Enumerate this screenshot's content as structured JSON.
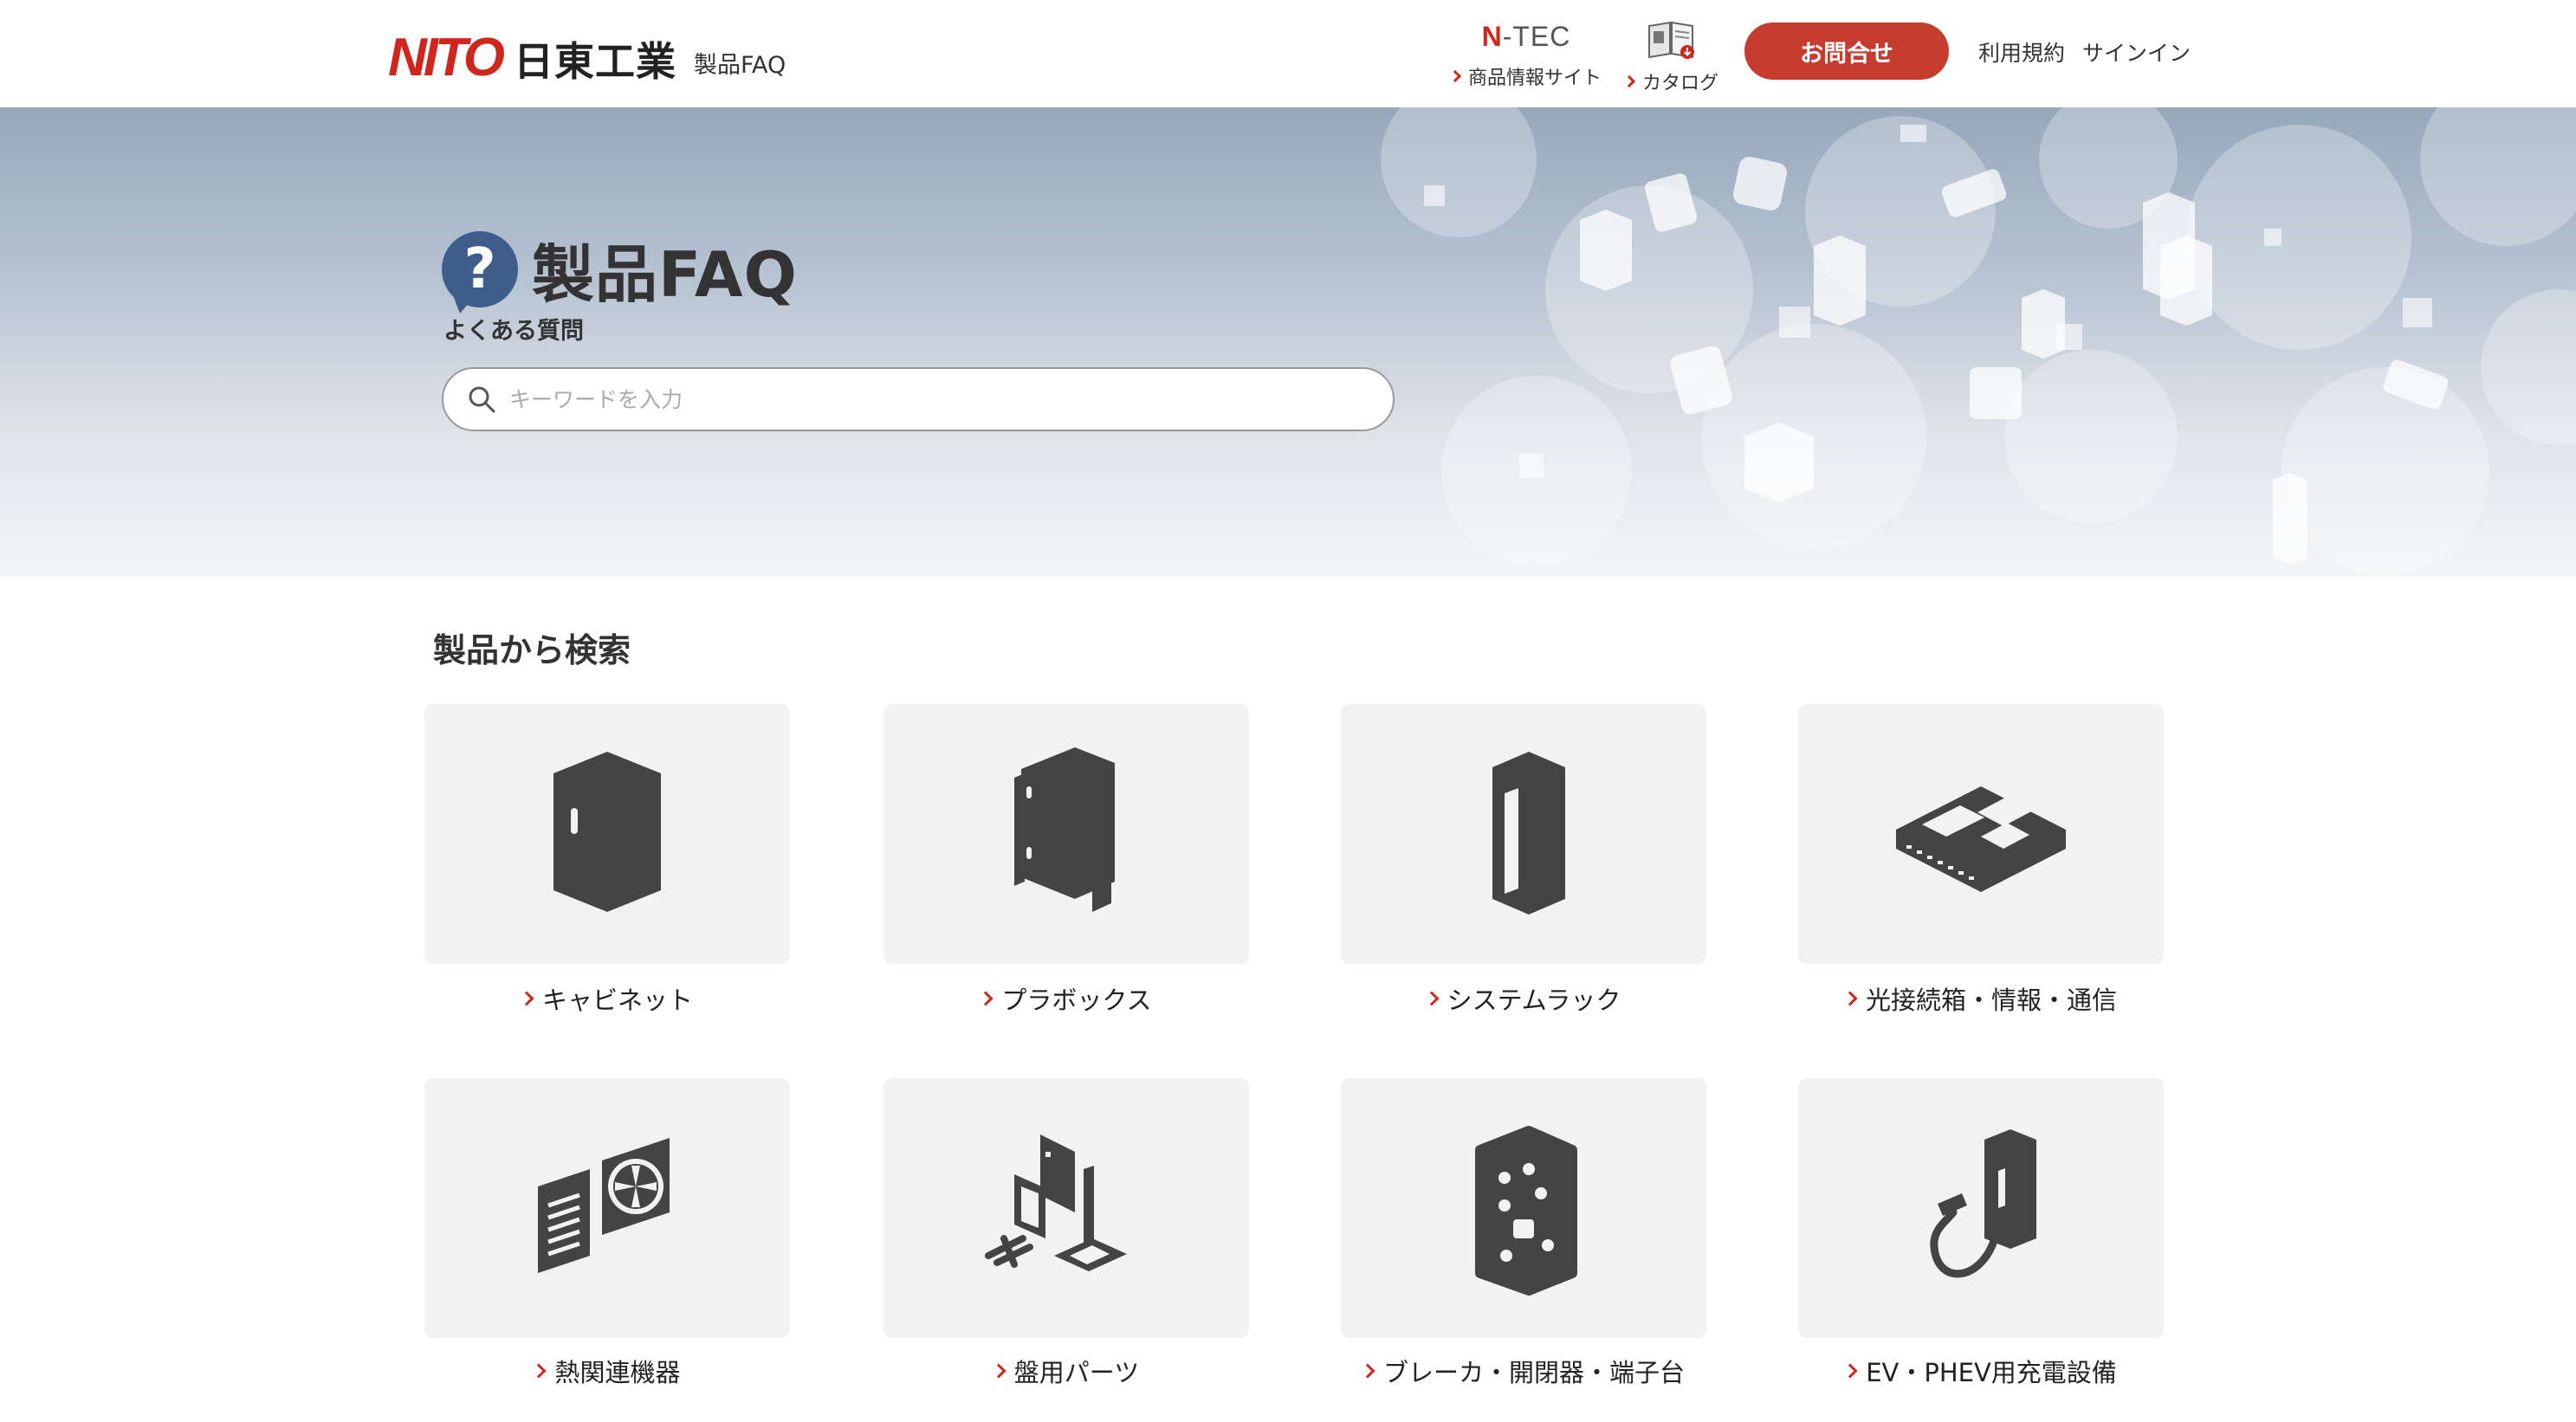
{
  "header": {
    "logo_mark": "NITO",
    "logo_kanji": "日東工業",
    "logo_sub": "製品FAQ",
    "ntec_logo_n": "N",
    "ntec_logo_rest": "-TEC",
    "ntec_link": "商品情報サイト",
    "catalog_link": "カタログ",
    "contact_button": "お問合せ",
    "terms_link": "利用規約",
    "signin_link": "サインイン",
    "accent_color": "#c63c2e"
  },
  "hero": {
    "title": "製品FAQ",
    "subtitle": "よくある質問",
    "question_mark": "?",
    "search_placeholder": "キーワードを入力"
  },
  "products": {
    "section_title": "製品から検索",
    "items": [
      {
        "label": "キャビネット",
        "icon": "cabinet-icon"
      },
      {
        "label": "プラボックス",
        "icon": "plastic-box-icon"
      },
      {
        "label": "システムラック",
        "icon": "system-rack-icon"
      },
      {
        "label": "光接続箱・情報・通信",
        "icon": "network-hub-icon"
      },
      {
        "label": "熱関連機器",
        "icon": "fan-heat-icon"
      },
      {
        "label": "盤用パーツ",
        "icon": "panel-parts-icon"
      },
      {
        "label": "ブレーカ・開閉器・端子台",
        "icon": "breaker-icon"
      },
      {
        "label": "EV・PHEV用充電設備",
        "icon": "ev-charger-icon"
      }
    ]
  }
}
